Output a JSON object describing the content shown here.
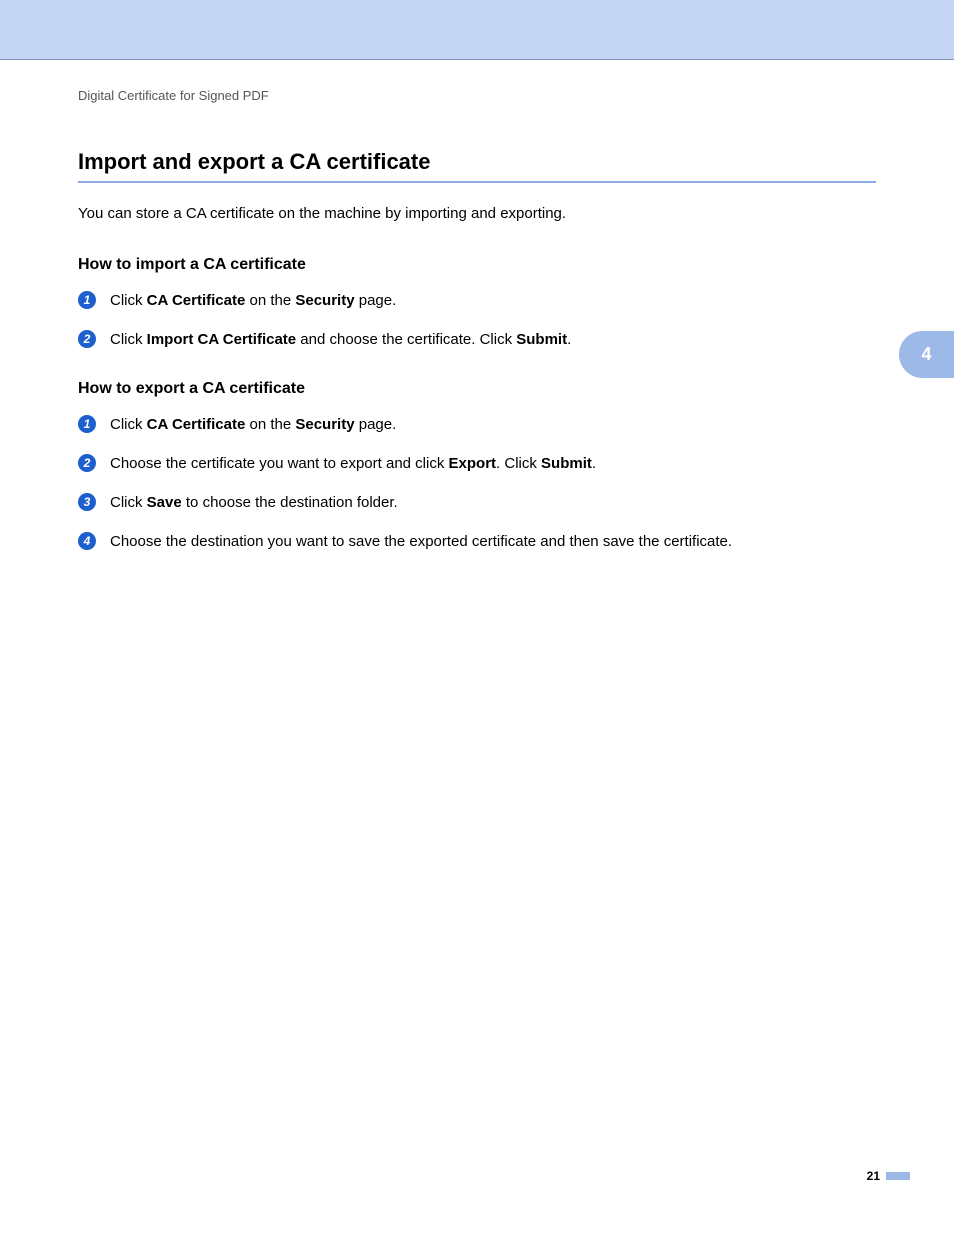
{
  "breadcrumb": "Digital Certificate for Signed PDF",
  "heading": "Import and export a CA certificate",
  "intro": "You can store a CA certificate on the machine by importing and exporting.",
  "chapter_tab": "4",
  "page_number": "21",
  "section_import": {
    "title": "How to import a CA certificate",
    "steps": [
      {
        "n": "1",
        "pre1": "Click ",
        "b1": "CA Certificate",
        "mid1": " on the ",
        "b2": "Security",
        "post1": " page."
      },
      {
        "n": "2",
        "pre1": "Click ",
        "b1": "Import CA Certificate",
        "mid1": " and choose the certificate. Click ",
        "b2": "Submit",
        "post1": "."
      }
    ]
  },
  "section_export": {
    "title": "How to export a CA certificate",
    "steps": [
      {
        "n": "1",
        "pre1": "Click ",
        "b1": "CA Certificate",
        "mid1": " on the ",
        "b2": "Security",
        "post1": " page."
      },
      {
        "n": "2",
        "pre1": "Choose the certificate you want to export and click ",
        "b1": "Export",
        "mid1": ". Click ",
        "b2": "Submit",
        "post1": "."
      },
      {
        "n": "3",
        "pre1": "Click ",
        "b1": "Save",
        "mid1": " to choose the destination folder.",
        "b2": "",
        "post1": ""
      },
      {
        "n": "4",
        "pre1": "Choose the destination you want to save the exported certificate and then save the certificate.",
        "b1": "",
        "mid1": "",
        "b2": "",
        "post1": ""
      }
    ]
  }
}
